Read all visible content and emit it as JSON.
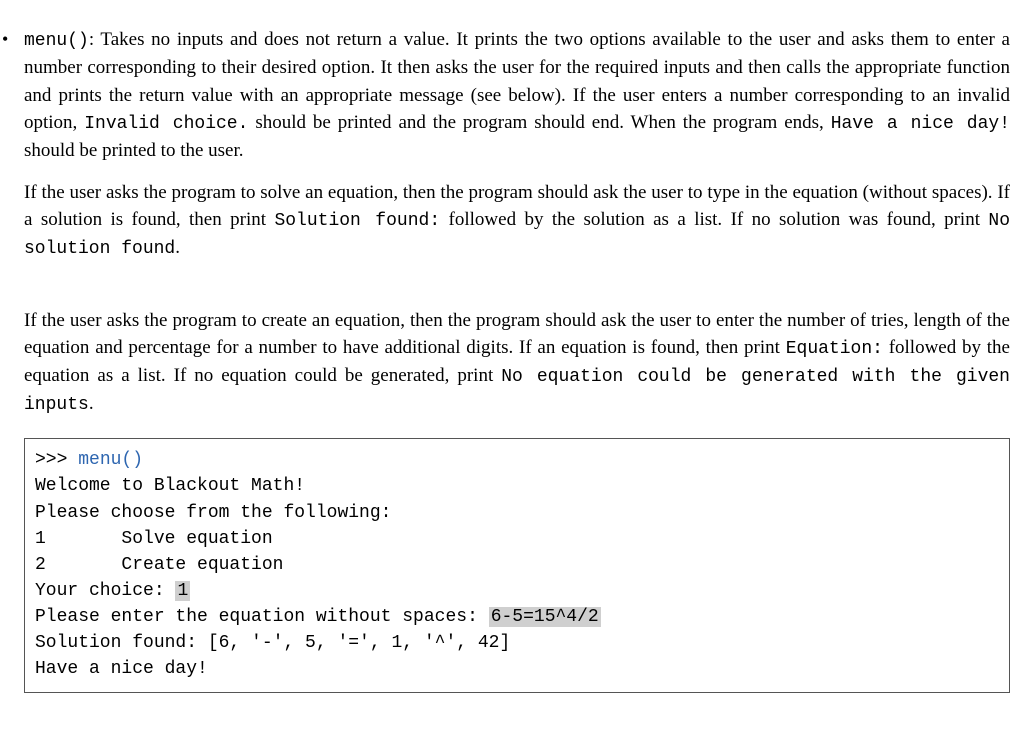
{
  "bullet": "•",
  "fn_name": "menu()",
  "p1_a": ":  Takes no inputs and does not return a value.  It prints the two options available to the user and asks them to enter a number corresponding to their desired option.  It then asks the user for the required inputs and then calls the appropriate function and prints the return value with an appropriate message (see below).  If the user enters a number corresponding to an invalid option, ",
  "p1_code1": "Invalid choice.",
  "p1_b": " should be printed and the program should end.  When the program ends, ",
  "p1_code2": "Have a nice day!",
  "p1_c": " should be printed to the user.",
  "p2_a": "If the user asks the program to solve an equation, then the program should ask the user to type in the equation (without spaces).  If a solution is found, then print ",
  "p2_code1": "Solution found:",
  "p2_b": " followed by the solution as a list.  If no solution was found, print ",
  "p2_code2": "No solution found",
  "p2_c": ".",
  "p3_a": "If the user asks the program to create an equation, then the program should ask the user to enter the number of tries, length of the equation and percentage for a number to have additional digits. If an equation is found, then print ",
  "p3_code1": "Equation:",
  "p3_b": " followed by the equation as a list.  If no equation could be generated, print ",
  "p3_code2": "No equation could be generated with the given inputs",
  "p3_c": ".",
  "code": {
    "prompt": ">>> ",
    "call": "menu()",
    "l1": "Welcome to Blackout Math!",
    "l2": "Please choose from the following:",
    "l3": "1       Solve equation",
    "l4": "2       Create equation",
    "l5a": "Your choice: ",
    "l5in": "1",
    "l6a": "Please enter the equation without spaces: ",
    "l6in": "6-5=15^4/2",
    "l7": "Solution found: [6, '-', 5, '=', 1, '^', 42]",
    "l8": "Have a nice day!"
  }
}
